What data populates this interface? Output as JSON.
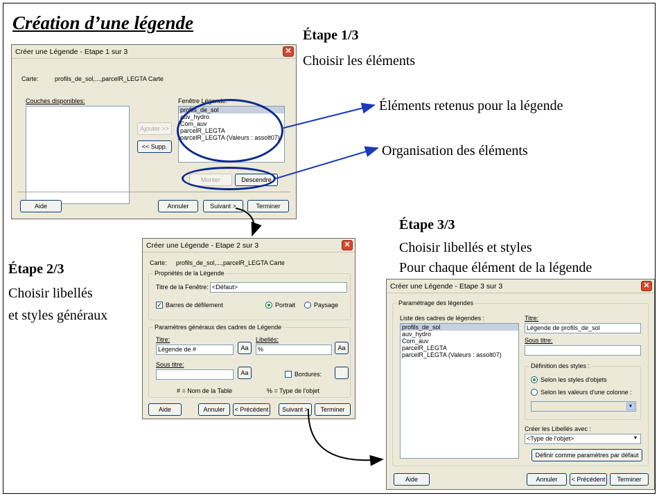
{
  "page": {
    "title": "Création d’une légende",
    "steps": {
      "step1": {
        "heading": "Étape 1/3",
        "lines": [
          "Choisir les éléments"
        ]
      },
      "step2": {
        "heading": "Étape 2/3",
        "lines": [
          "Choisir libellés",
          "et styles généraux"
        ]
      },
      "step3": {
        "heading": "Étape 3/3",
        "lines": [
          "Choisir libellés et styles",
          "Pour chaque élément de la légende"
        ]
      }
    },
    "callouts": {
      "elements": "Éléments retenus pour la légende",
      "organisation": "Organisation des éléments"
    },
    "arrow_color": "#1a3ab8",
    "circle_color": "#0b2a8c"
  },
  "dialog1": {
    "title": "Créer une Légende - Etape 1 sur 3",
    "close": "✕",
    "carte_label": "Carte:",
    "carte_value": "profils_de_sol,...,parcelR_LEGTA Carte",
    "couches_label": "Couches disponibles:",
    "fenetre_label": "Fenêtre Légende:",
    "legend_items": [
      "profils_de_sol",
      "auv_hydro",
      "Com_auv",
      "parcelR_LEGTA",
      "parcelR_LEGTA (Valeurs : assolt07)"
    ],
    "buttons": {
      "ajouter": "Ajouter >>",
      "supp": "<< Supp.",
      "monter": "Monter",
      "descendre": "Descendre",
      "aide": "Aide",
      "annuler": "Annuler",
      "suivant": "Suivant >",
      "terminer": "Terminer"
    }
  },
  "dialog2": {
    "title": "Créer une Légende - Etape 2 sur 3",
    "close": "✕",
    "carte_label": "Carte:",
    "carte_value": "profils_de_sol,...,parcelR_LEGTA Carte",
    "props_group": "Propriétés de la Légende",
    "titre_fenetre_label": "Titre de la Fenêtre:",
    "titre_fenetre_value": "<Défaut>",
    "barres_label": "Barres de défilement",
    "portrait_label": "Portrait",
    "paysage_label": "Paysage",
    "params_group": "Paramètres généraux des cadres de Légende",
    "titre_label": "Titre:",
    "titre_value": "Légende de #",
    "libelles_label": "Libellés:",
    "libelles_value": "%",
    "sous_titre_label": "Sous titre:",
    "sous_titre_value": "",
    "bordures_label": "Bordures:",
    "aa": "Aa",
    "note_hash": "# = Nom de la Table",
    "note_pct": "% = Type de l'objet",
    "buttons": {
      "aide": "Aide",
      "annuler": "Annuler",
      "precedent": "< Précédent",
      "suivant": "Suivant >",
      "terminer": "Terminer"
    }
  },
  "dialog3": {
    "title": "Créer une Légende - Etape 3 sur 3",
    "close": "✕",
    "param_group": "Paramétrage des légendes",
    "liste_label": "Liste des cadres de légendes :",
    "liste_items": [
      "profils_de_sol",
      "auv_hydro",
      "Com_auv",
      "parcelR_LEGTA",
      "parcelR_LEGTA (Valeurs : assolt07)"
    ],
    "titre_label": "Titre:",
    "titre_value": "Légende de profils_de_sol",
    "sous_titre_label": "Sous titre:",
    "sous_titre_value": "",
    "def_group": "Définition des styles :",
    "radio_objets": "Selon les styles d'objets",
    "radio_valeurs": "Selon les valeurs d'une colonne :",
    "creer_label": "Créer les Libellés avec :",
    "creer_value": "<Type de l'objet>",
    "defaut_btn": "Définir comme paramètres par défaut",
    "buttons": {
      "aide": "Aide",
      "annuler": "Annuler",
      "precedent": "< Précédent",
      "terminer": "Terminer"
    }
  }
}
